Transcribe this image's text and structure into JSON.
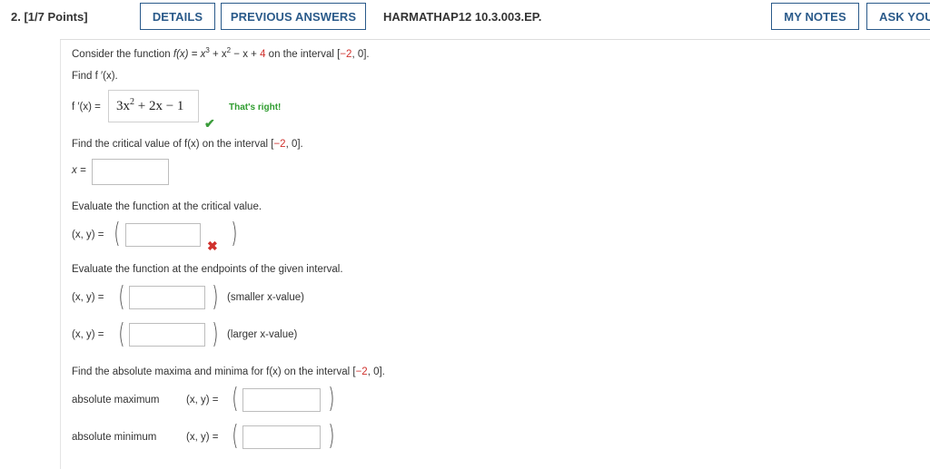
{
  "header": {
    "question_number": "2.",
    "points": "[1/7 Points]",
    "details_label": "DETAILS",
    "previous_answers_label": "PREVIOUS ANSWERS",
    "problem_code": "HARMATHAP12 10.3.003.EP.",
    "my_notes_label": "MY NOTES",
    "ask_your_label": "ASK YOU"
  },
  "question": {
    "intro_prefix": "Consider the function ",
    "intro_function": "f(x) = x",
    "intro_exp3": "3",
    "intro_plus_x": " + x",
    "intro_exp2": "2",
    "intro_minus": " − x + ",
    "intro_constant": "4",
    "intro_interval_prefix": " on the interval [",
    "interval_left": "−2",
    "interval_sep": ", 0].",
    "find_derivative": "Find f ′(x).",
    "derivative_label": "f ′(x) =",
    "derivative_answer_a": "3x",
    "derivative_answer_exp": "2",
    "derivative_answer_b": " + 2x − 1",
    "feedback_correct": "That's right!",
    "find_critical": "Find the critical value of f(x) on the interval [",
    "find_critical_interval_left": "−2",
    "find_critical_interval_rest": ", 0].",
    "critical_label": "x =",
    "evaluate_critical": "Evaluate the function at the critical value.",
    "xy_label": "(x, y) =",
    "evaluate_endpoints": "Evaluate the function at the endpoints of the given interval.",
    "smaller_label": "(smaller x-value)",
    "larger_label": "(larger x-value)",
    "find_absolute": "Find the absolute maxima and minima for f(x) on the interval [",
    "find_absolute_interval_left": "−2",
    "find_absolute_interval_rest": ", 0].",
    "abs_max_label": "absolute maximum",
    "abs_min_label": "absolute minimum"
  },
  "colors": {
    "button_accent": "#2a5a8a",
    "correct_green": "#2e9c2e",
    "wrong_red": "#d0312d"
  },
  "icons": {
    "correct": "check-icon",
    "incorrect": "x-mark-icon"
  }
}
